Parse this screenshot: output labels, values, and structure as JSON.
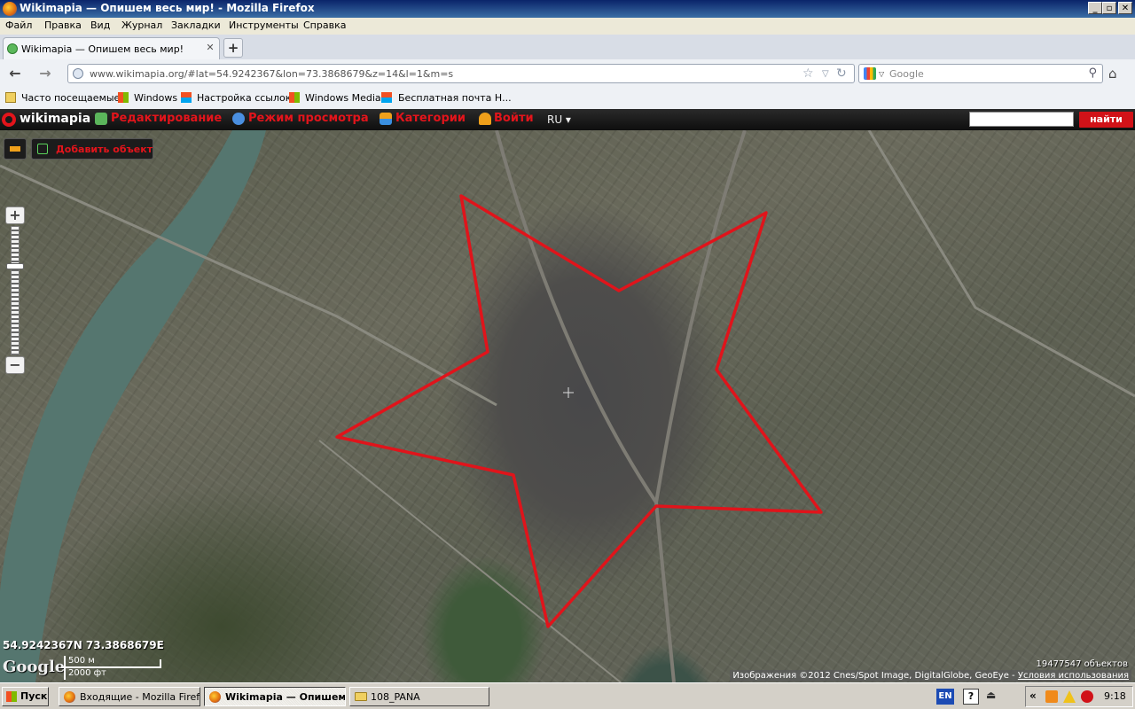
{
  "window": {
    "title": "Wikimapia — Опишем весь мир! - Mozilla Firefox",
    "minimize": "_",
    "maximize": "▫",
    "close": "✕"
  },
  "menu": [
    "Файл",
    "Правка",
    "Вид",
    "Журнал",
    "Закладки",
    "Инструменты",
    "Справка"
  ],
  "tab": {
    "label": "Wikimapia — Опишем весь мир!",
    "close": "✕",
    "new_tab": "+"
  },
  "nav": {
    "back": "←",
    "forward": "→",
    "url": "www.wikimapia.org/#lat=54.9242367&lon=73.3868679&z=14&l=1&m=s",
    "search_placeholder": "Google",
    "star": "☆",
    "dropdown": "▽",
    "reload": "↻",
    "search_glyph": "⚲",
    "home": "⌂"
  },
  "bookmarks": [
    "Часто посещаемые",
    "Windows",
    "Настройка ссылок",
    "Windows Media",
    "Бесплатная почта Н..."
  ],
  "wikimapia": {
    "logo": "wikimapia",
    "items": [
      "Редактирование",
      "Режим просмотра",
      "Категории",
      "Войти"
    ],
    "lang": "RU ▾",
    "search_button": "найти",
    "add_object": "Добавить объект",
    "zoom_in": "+",
    "zoom_out": "−"
  },
  "map": {
    "coords": "54.9242367N 73.3868679E",
    "google": "Google",
    "scale_metric": "500 м",
    "scale_imperial": "2000 фт",
    "object_count": "19477547 объектов",
    "attribution": "Изображения ©2012 Cnes/Spot Image, DigitalGlobe, GeoEye -",
    "terms": "Условия использования",
    "polygon_color": "#e0141b"
  },
  "taskbar": {
    "start": "Пуск",
    "tasks": [
      "Входящие - Mozilla Firefox",
      "Wikimapia — Опишем ве...",
      "108_PANA"
    ],
    "lang": "EN",
    "help": "?",
    "usb": "⏏",
    "tray_chevron": "«",
    "time": "9:18"
  }
}
